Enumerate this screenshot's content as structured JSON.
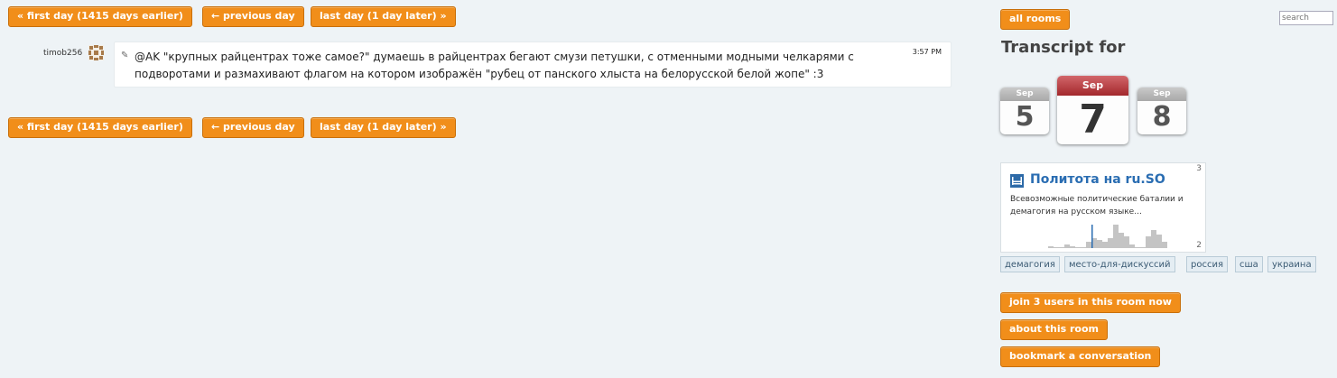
{
  "nav": {
    "first_day": "« first day (1415 days earlier)",
    "previous_day": "← previous day",
    "last_day": "last day (1 day later) »"
  },
  "message": {
    "username": "timob256",
    "text": "@AK \"крупных райцентрах тоже самое?\" думаешь в райцентрах бегают смузи петушки, с отменными модными челкарями с подворотами и размахивают флагом на котором изображён \"рубец от панского хлыста на белорусской белой жопе\" :3",
    "time": "3:57 PM",
    "edit_icon": "pencil-icon",
    "avatar_icon": "identicon-avatar"
  },
  "sidebar": {
    "all_rooms": "all rooms",
    "search_placeholder": "search",
    "transcript_title": "Transcript for",
    "calendar": {
      "prev": {
        "month": "Sep",
        "day": "5"
      },
      "current": {
        "month": "Sep",
        "day": "7"
      },
      "next": {
        "month": "Sep",
        "day": "8"
      }
    },
    "room": {
      "name": "Политота на ru.SO",
      "description": "Всевозможные политические баталии и демагогия на русском языке...",
      "count_top": "3",
      "count_bottom": "2",
      "icon": "stackoverflow-icon",
      "activity": [
        1,
        0,
        0,
        2,
        1,
        0,
        0,
        3,
        5,
        4,
        3,
        5,
        12,
        8,
        6,
        2,
        0,
        0,
        6,
        9,
        7,
        3
      ]
    },
    "tags": [
      "демагогия",
      "место-для-дискуссий",
      "россия",
      "сша",
      "украина"
    ],
    "join": "join 3 users in this room now",
    "about": "about this room",
    "bookmark": "bookmark a conversation"
  },
  "colors": {
    "accent": "#f18e1a",
    "background": "#eef3f6",
    "link": "#2a6db2",
    "calendar_current": "#a3282c"
  }
}
